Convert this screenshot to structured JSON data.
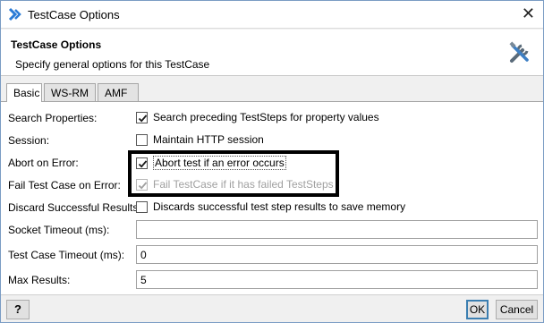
{
  "window": {
    "title": "TestCase Options",
    "close_label": "✕"
  },
  "banner": {
    "title": "TestCase Options",
    "description": "Specify general options for this TestCase"
  },
  "tabs": [
    {
      "label": "Basic",
      "active": true
    },
    {
      "label": "WS-RM",
      "active": false
    },
    {
      "label": "AMF",
      "active": false
    }
  ],
  "fields": {
    "search_properties": {
      "label": "Search Properties:",
      "checkbox_label": "Search preceding TestSteps for property values",
      "checked": true,
      "enabled": true
    },
    "session": {
      "label": "Session:",
      "checkbox_label": "Maintain HTTP session",
      "checked": false,
      "enabled": true
    },
    "abort_on_error": {
      "label": "Abort on Error:",
      "checkbox_label": "Abort test if an error occurs",
      "checked": true,
      "enabled": true
    },
    "fail_test_case": {
      "label": "Fail Test Case on Error:",
      "checkbox_label": "Fail TestCase if it has failed TestSteps",
      "checked": true,
      "enabled": false
    },
    "discard_results": {
      "label": "Discard Successful Results:",
      "checkbox_label": "Discards successful test step results to save memory",
      "checked": false,
      "enabled": true
    },
    "socket_timeout": {
      "label": "Socket Timeout (ms):",
      "value": ""
    },
    "test_case_timeout": {
      "label": "Test Case Timeout (ms):",
      "value": "0"
    },
    "max_results": {
      "label": "Max Results:",
      "value": "5"
    }
  },
  "footer": {
    "help_label": "?",
    "ok_label": "OK",
    "cancel_label": "Cancel"
  },
  "icons": {
    "app": "soapui-logo-icon",
    "banner": "tools-icon"
  },
  "colors": {
    "app_icon": "#2a7bd6",
    "checkbox_check": "#1a1a1a",
    "disabled_text": "#a0a0a0",
    "highlight": "#000000"
  }
}
